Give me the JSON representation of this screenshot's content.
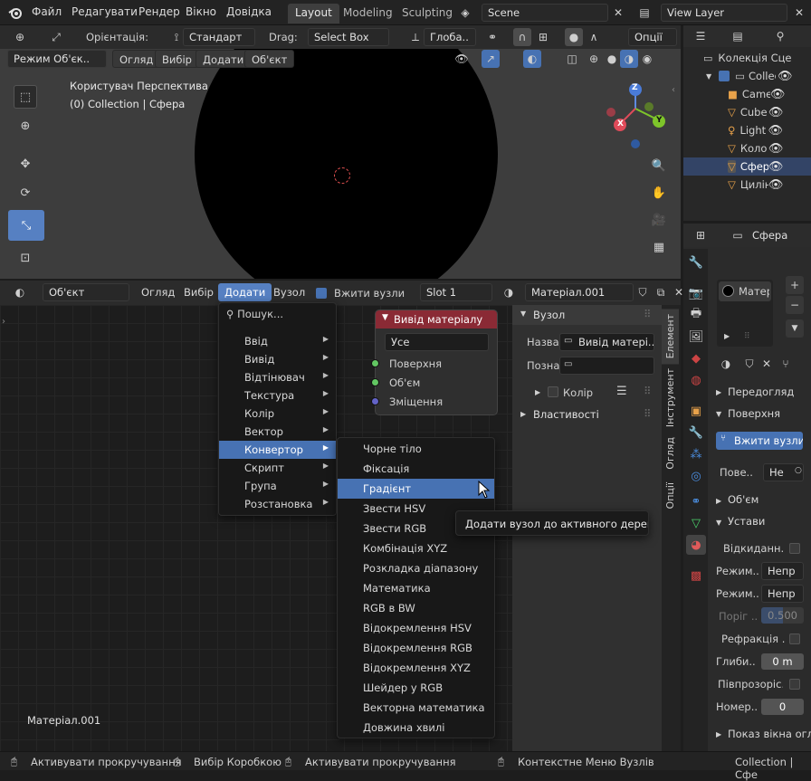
{
  "topbar": {
    "menus": [
      "Файл",
      "Редагувати",
      "Рендер",
      "Вікно",
      "Довідка"
    ],
    "workspaces": [
      "Layout",
      "Modeling",
      "Sculpting"
    ],
    "active_workspace": "Layout",
    "scene": "Scene",
    "view_layer": "View Layer"
  },
  "viewport_header": {
    "orientation_label": "Орієнтація:",
    "orientation_value": "Стандарт",
    "drag_label": "Drag:",
    "drag_value": "Select Box",
    "transform_value": "Глоба..",
    "options": "Опції"
  },
  "viewport_header2": {
    "mode": "Режим Об'єк..",
    "menus": [
      "Огляд",
      "Вибір",
      "Додати",
      "Об'єкт"
    ]
  },
  "viewport": {
    "view_name": "Користувач Перспектива",
    "collection_info": "(0) Collection | Сфера",
    "gizmo": {
      "x": "X",
      "y": "Y",
      "z": "Z"
    }
  },
  "node_header": {
    "editor_type": "Об'єкт",
    "menus": [
      "Огляд",
      "Вибір",
      "Додати",
      "Вузол"
    ],
    "active_menu": "Додати",
    "use_nodes_label": "Вжити вузли",
    "slot": "Slot 1",
    "material": "Матеріал.001"
  },
  "add_menu": {
    "search": "Пошук...",
    "items": [
      "Ввід",
      "Вивід",
      "Відтінювач",
      "Текстура",
      "Колір",
      "Вектор",
      "Конвертор",
      "Скрипт",
      "Група",
      "Розстановка"
    ],
    "active": "Конвертор"
  },
  "converter_submenu": {
    "items": [
      "Чорне тіло",
      "Фіксація",
      "Градієнт",
      "Звести HSV",
      "Звести RGB",
      "Комбінація XYZ",
      "Розкладка діапазону",
      "Математика",
      "RGB в BW",
      "Відокремлення HSV",
      "Відокремлення RGB",
      "Відокремлення XYZ",
      "Шейдер у RGB",
      "Векторна математика",
      "Довжина хвилі"
    ],
    "active": "Градієнт"
  },
  "tooltip": "Додати вузол до активного дерева.",
  "output_node": {
    "title": "Вивід матеріалу",
    "target": "Усе",
    "sockets": [
      {
        "name": "Поверхня",
        "color": "#63c763"
      },
      {
        "name": "Об'єм",
        "color": "#63c763"
      },
      {
        "name": "Зміщення",
        "color": "#6363c7"
      }
    ]
  },
  "node_editor": {
    "material_label": "Матеріал.001"
  },
  "sidebar": {
    "section_node": "Вузол",
    "name_label": "Назва",
    "name_value": "Вивід матері..",
    "label_label": "Позна",
    "color_label": "Колір",
    "properties_label": "Властивості",
    "tabs": [
      "Елемент",
      "Інструмент",
      "Огляд",
      "Опції"
    ]
  },
  "outliner": {
    "title": "Колекція Сце",
    "items": [
      {
        "name": "Collec",
        "icon": "collection"
      },
      {
        "name": "Came",
        "icon": "camera",
        "color": "#e8a24a"
      },
      {
        "name": "Cube",
        "icon": "mesh",
        "color": "#e8a24a"
      },
      {
        "name": "Light",
        "icon": "light",
        "color": "#e8a24a"
      },
      {
        "name": "Коло",
        "icon": "mesh",
        "color": "#e8a24a"
      },
      {
        "name": "Сфер",
        "icon": "mesh",
        "color": "#e8a24a"
      },
      {
        "name": "Цилін",
        "icon": "mesh",
        "color": "#e8a24a"
      }
    ]
  },
  "properties": {
    "object": "Сфера",
    "material_slot": "Матер",
    "sections": {
      "preview": "Передогляд",
      "surface": "Поверхня",
      "volume": "Об'єм",
      "settings": "Устави",
      "backface": "Показ вікна огл"
    },
    "use_nodes_button": "Вжити вузли",
    "surface_label": "Пове..",
    "surface_value": "Не",
    "backface_culling": "Відкиданн..",
    "blend_mode_label": "Режим..",
    "blend_mode_value": "Непр",
    "shadow_mode_label": "Режим..",
    "shadow_mode_value": "Непр",
    "threshold_label": "Поріг ..",
    "threshold_value": "0.500",
    "refraction_label": "Рефракція ..",
    "depth_label": "Глиби..",
    "depth_value": "0 m",
    "subsurface_label": "Півпрозоріс..",
    "pass_index_label": "Номер..",
    "pass_index_value": "0"
  },
  "statusbar": {
    "items": [
      "Активувати прокручування",
      "Вибір Коробкою",
      "Активувати прокручування",
      "Контекстне Меню Вузлів"
    ],
    "right": "Collection | Сфе"
  }
}
